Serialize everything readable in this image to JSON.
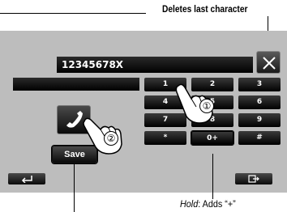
{
  "annotations": {
    "delete_label": "Deletes last character",
    "hold_prefix": "Hold",
    "hold_text": ": Adds “+”"
  },
  "display": {
    "number": "12345678X"
  },
  "keypad": {
    "keys": [
      "1",
      "2",
      "3",
      "4",
      "5",
      "6",
      "7",
      "8",
      "9",
      "*",
      "0+",
      "#"
    ]
  },
  "buttons": {
    "save_label": "Save",
    "delete_icon": "close-x-icon",
    "call_icon": "phone-handset-icon",
    "back_icon": "return-arrow-icon",
    "exit_icon": "exit-door-icon"
  },
  "callouts": [
    "①",
    "②"
  ],
  "colors": {
    "screen_bg": "#bdbdbd",
    "button_dark": "#000000",
    "text": "#ffffff"
  }
}
